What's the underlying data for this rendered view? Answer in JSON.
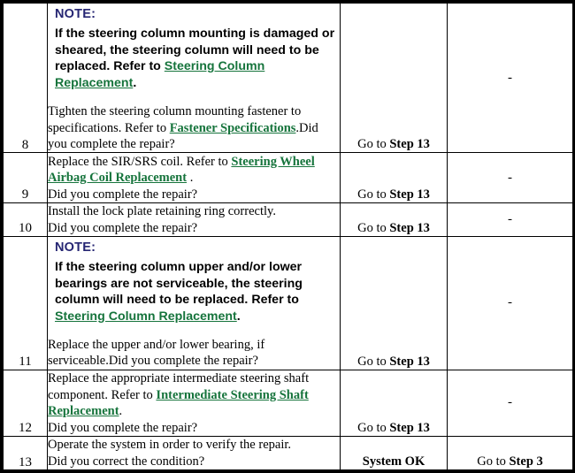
{
  "table": {
    "link_color": "#16743c",
    "note_label_color": "#262673",
    "note_label": "NOTE:",
    "rows": [
      {
        "step": "8",
        "note": {
          "label": "NOTE:",
          "text_before_link": "If the steering column mounting is damaged or sheared, the steering column will need to be replaced. Refer to ",
          "link": "Steering Column Replacement",
          "text_after_link": "."
        },
        "body": {
          "text_before_link": "Tighten the steering column mounting fastener to specifications. Refer to ",
          "link": "Fastener Specifications",
          "text_after_link": ".Did you complete the repair?"
        },
        "yes": {
          "prefix": "Go to ",
          "bold": "Step 13"
        },
        "no": "-"
      },
      {
        "step": "9",
        "body": {
          "text_before_link": "Replace the SIR/SRS coil. Refer to ",
          "link": "Steering Wheel Airbag Coil Replacement",
          "text_after_link": " ."
        },
        "body_line2": "Did you complete the repair?",
        "yes": {
          "prefix": "Go to ",
          "bold": "Step 13"
        },
        "no": "-"
      },
      {
        "step": "10",
        "body_line1": "Install the lock plate retaining ring correctly.",
        "body_line2": "Did you complete the repair?",
        "yes": {
          "prefix": "Go to ",
          "bold": "Step 13"
        },
        "no": "-"
      },
      {
        "step": "11",
        "note": {
          "label": "NOTE:",
          "text_before_link": "If the steering column upper and/or lower bearings are not serviceable, the steering column will need to be replaced. Refer to ",
          "link": "Steering Column Replacement",
          "text_after_link": "."
        },
        "body_plain": "Replace the upper and/or lower bearing, if serviceable.Did you complete the repair?",
        "yes": {
          "prefix": "Go to ",
          "bold": "Step 13"
        },
        "no": "-"
      },
      {
        "step": "12",
        "body": {
          "text_before_link": "Replace the appropriate intermediate steering shaft component. Refer to ",
          "link": "Intermediate Steering Shaft Replacement",
          "text_after_link": "."
        },
        "body_line2": "Did you complete the repair?",
        "yes": {
          "prefix": "Go to ",
          "bold": "Step 13"
        },
        "no": "-"
      },
      {
        "step": "13",
        "body_line1": "Operate the system in order to verify the repair.",
        "body_line2": "Did you correct the condition?",
        "yes": {
          "prefix": "",
          "bold": "System OK"
        },
        "no": {
          "prefix": "Go to ",
          "bold": "Step 3"
        }
      }
    ]
  }
}
